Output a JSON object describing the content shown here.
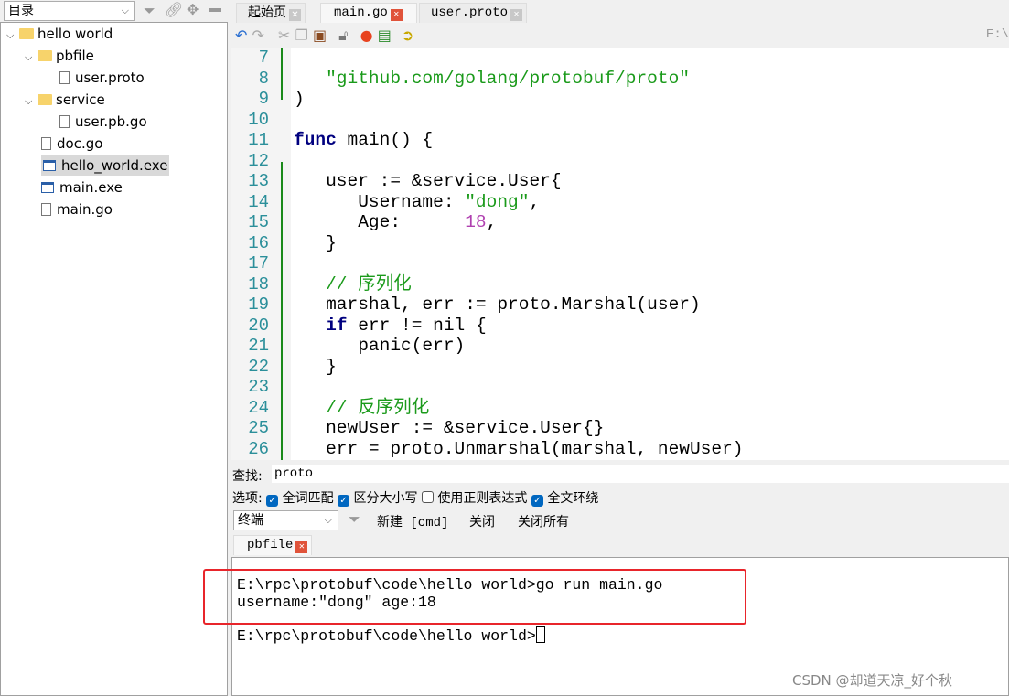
{
  "sidebar": {
    "dropdown": "目录",
    "tree": [
      {
        "label": "hello world",
        "type": "folder",
        "level": 0
      },
      {
        "label": "pbfile",
        "type": "folder",
        "level": 1
      },
      {
        "label": "user.proto",
        "type": "file",
        "level": 2
      },
      {
        "label": "service",
        "type": "folder",
        "level": 1
      },
      {
        "label": "user.pb.go",
        "type": "file",
        "level": 2
      },
      {
        "label": "doc.go",
        "type": "file",
        "level": 1
      },
      {
        "label": "hello_world.exe",
        "type": "exe",
        "level": 1,
        "selected": true
      },
      {
        "label": "main.exe",
        "type": "exe",
        "level": 1
      },
      {
        "label": "main.go",
        "type": "file",
        "level": 1
      }
    ]
  },
  "tabs": [
    {
      "label": "起始页"
    },
    {
      "label": "main.go",
      "active": true
    },
    {
      "label": "user.proto"
    }
  ],
  "toolbar": {
    "path": "E:\\"
  },
  "editor": {
    "lines": [
      "7",
      "8",
      "9",
      "10",
      "11",
      "12",
      "13",
      "14",
      "15",
      "16",
      "17",
      "18",
      "19",
      "20",
      "21",
      "22",
      "23",
      "24",
      "25",
      "26"
    ]
  },
  "find": {
    "label": "查找:",
    "value": "proto"
  },
  "options": {
    "label": "选项:",
    "items": [
      {
        "label": "全词匹配",
        "checked": true
      },
      {
        "label": "区分大小写",
        "checked": true
      },
      {
        "label": "使用正则表达式",
        "checked": false
      },
      {
        "label": "全文环绕",
        "checked": true
      }
    ]
  },
  "console": {
    "dropdown": "终端",
    "new": "新建 [cmd]",
    "close": "关闭",
    "close_all": "关闭所有",
    "tab": "pbfile",
    "lines": [
      "E:\\rpc\\protobuf\\code\\hello world>go run main.go",
      "username:\"dong\" age:18",
      "E:\\rpc\\protobuf\\code\\hello world>"
    ]
  },
  "watermark": "CSDN @却道天凉_好个秋",
  "colors": {
    "highlight_box": "#e8252b",
    "accent": "#0067c0"
  }
}
